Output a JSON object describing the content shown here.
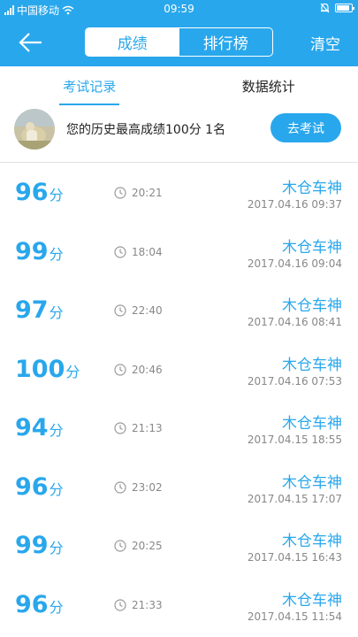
{
  "status_bar": {
    "carrier": "中国移动",
    "time": "09:59",
    "icons": [
      "signal-icon",
      "wifi-icon",
      "alarm-icon",
      "battery-icon"
    ]
  },
  "header": {
    "tabs": [
      {
        "label": "成绩",
        "active": true
      },
      {
        "label": "排行榜",
        "active": false
      }
    ],
    "right_action": "清空",
    "back_icon": "arrow-left-icon"
  },
  "subtabs": [
    {
      "label": "考试记录",
      "active": true
    },
    {
      "label": "数据统计",
      "active": false
    }
  ],
  "profile": {
    "summary": "您的历史最高成绩100分  1名",
    "button": "去考试"
  },
  "records": [
    {
      "score": "96",
      "unit": "分",
      "duration": "20:21",
      "user": "木仓车神",
      "date": "2017.04.16  09:37"
    },
    {
      "score": "99",
      "unit": "分",
      "duration": "18:04",
      "user": "木仓车神",
      "date": "2017.04.16  09:04"
    },
    {
      "score": "97",
      "unit": "分",
      "duration": "22:40",
      "user": "木仓车神",
      "date": "2017.04.16  08:41"
    },
    {
      "score": "100",
      "unit": "分",
      "duration": "20:46",
      "user": "木仓车神",
      "date": "2017.04.16  07:53"
    },
    {
      "score": "94",
      "unit": "分",
      "duration": "21:13",
      "user": "木仓车神",
      "date": "2017.04.15  18:55"
    },
    {
      "score": "96",
      "unit": "分",
      "duration": "23:02",
      "user": "木仓车神",
      "date": "2017.04.15  17:07"
    },
    {
      "score": "99",
      "unit": "分",
      "duration": "20:25",
      "user": "木仓车神",
      "date": "2017.04.15  16:43"
    },
    {
      "score": "96",
      "unit": "分",
      "duration": "21:33",
      "user": "木仓车神",
      "date": "2017.04.15  11:54"
    }
  ],
  "colors": {
    "accent": "#29a7ec",
    "text": "#222222",
    "muted": "#888888"
  }
}
